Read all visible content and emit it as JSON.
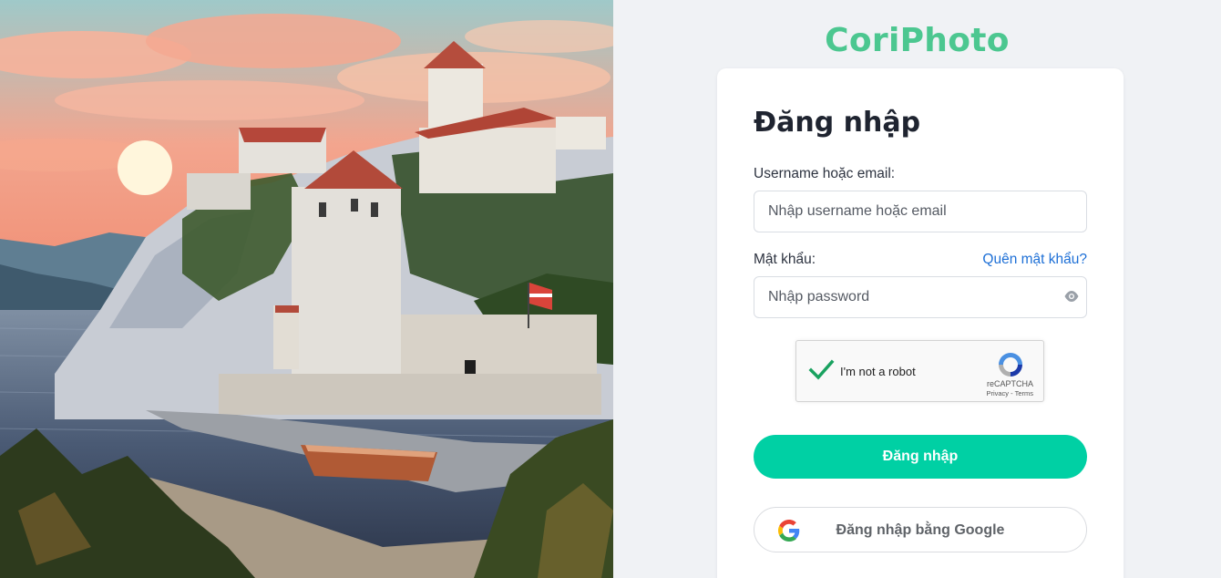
{
  "brand": {
    "name": "CoriPhoto",
    "color": "#4cc790"
  },
  "form": {
    "title": "Đăng nhập",
    "username_label": "Username hoặc email:",
    "username_placeholder": "Nhập username hoặc email",
    "username_value": "",
    "password_label": "Mật khẩu:",
    "password_placeholder": "Nhập password",
    "password_value": "",
    "forgot_link": "Quên mật khẩu?",
    "submit_label": "Đăng nhập",
    "submit_color": "#00d0a4",
    "google_label": "Đăng nhập bằng Google"
  },
  "captcha": {
    "checkbox_text": "I'm not a robot",
    "checked": true,
    "brand": "reCAPTCHA",
    "links": "Privacy - Terms"
  },
  "icons": {
    "eye": "eye-icon",
    "captcha_check": "checkmark-icon",
    "captcha_logo": "recaptcha-logo-icon",
    "google": "google-logo-icon"
  }
}
